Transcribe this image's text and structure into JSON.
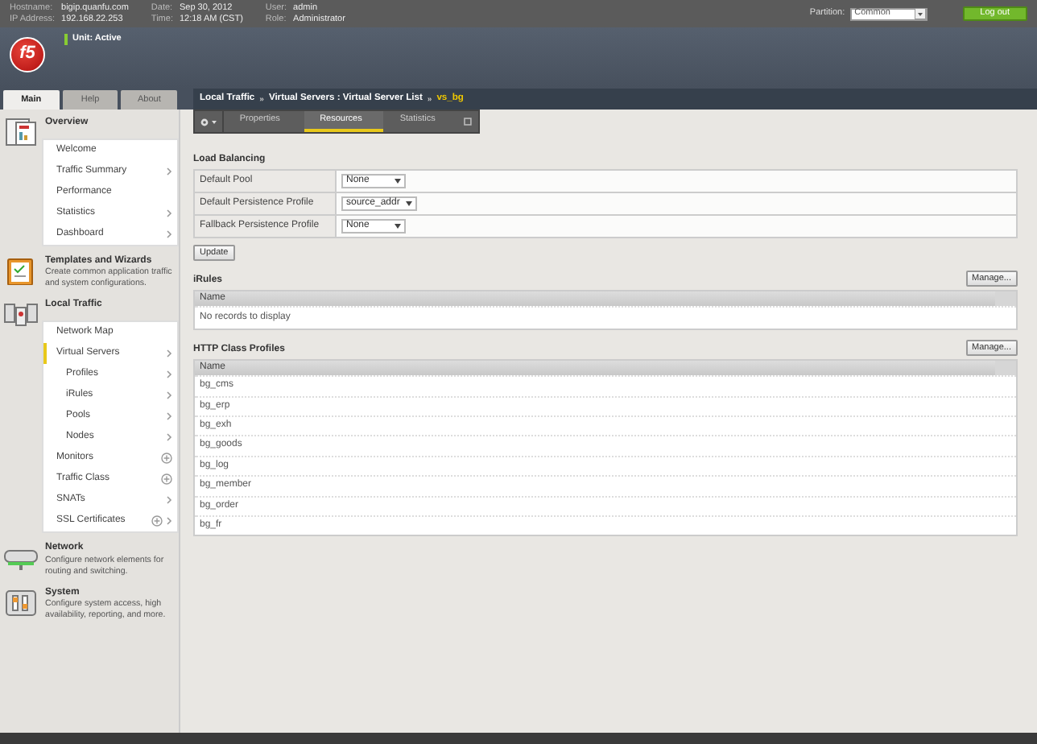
{
  "header": {
    "fields": [
      {
        "label": "Hostname:",
        "value": "bigip.quanfu.com"
      },
      {
        "label": "IP Address:",
        "value": "192.168.22.253"
      },
      {
        "label": "Date:",
        "value": "Sep 30, 2012"
      },
      {
        "label": "Time:",
        "value": "12:18 AM (CST)"
      },
      {
        "label": "User:",
        "value": "admin"
      },
      {
        "label": "Role:",
        "value": "Administrator"
      }
    ],
    "partition": {
      "label": "Partition:",
      "value": "Common"
    },
    "logout": "Log out"
  },
  "banner": {
    "logo": "f5",
    "unit_status": "Unit: Active"
  },
  "side_tabs": [
    {
      "label": "Main",
      "selected": true
    },
    {
      "label": "Help",
      "selected": false
    },
    {
      "label": "About",
      "selected": false
    }
  ],
  "sidebar": [
    {
      "title": "Overview",
      "items": [
        {
          "label": "Welcome",
          "selected": false,
          "submenu": false,
          "add": false
        },
        {
          "label": "Traffic Summary",
          "selected": false,
          "submenu": true,
          "add": false
        },
        {
          "label": "Performance",
          "selected": false,
          "submenu": false,
          "add": false
        },
        {
          "label": "Statistics",
          "selected": false,
          "submenu": true,
          "add": false
        },
        {
          "label": "Dashboard",
          "selected": false,
          "submenu": true,
          "add": false
        }
      ]
    },
    {
      "title": "Templates and Wizards",
      "description": "Create common application traffic and system configurations."
    },
    {
      "title": "Local Traffic",
      "items": [
        {
          "label": "Network Map",
          "selected": false,
          "submenu": false,
          "add": false
        },
        {
          "label": "Virtual Servers",
          "selected": true,
          "submenu": true,
          "add": false,
          "children": [
            {
              "label": "Profiles",
              "selected": false,
              "submenu": true,
              "add": false
            },
            {
              "label": "iRules",
              "selected": false,
              "submenu": true,
              "add": false
            },
            {
              "label": "Pools",
              "selected": false,
              "submenu": true,
              "add": false
            },
            {
              "label": "Nodes",
              "selected": false,
              "submenu": true,
              "add": false
            }
          ]
        },
        {
          "label": "Monitors",
          "selected": false,
          "submenu": false,
          "add": true
        },
        {
          "label": "Traffic Class",
          "selected": false,
          "submenu": false,
          "add": true
        },
        {
          "label": "SNATs",
          "selected": false,
          "submenu": true,
          "add": false
        },
        {
          "label": "SSL Certificates",
          "selected": false,
          "submenu": true,
          "add": true
        }
      ]
    },
    {
      "title": "Network",
      "description": "Configure network elements for routing and switching."
    },
    {
      "title": "System",
      "description": "Configure system access, high availability, reporting, and more."
    }
  ],
  "breadcrumb": {
    "parts": [
      "Local Traffic",
      "Virtual Servers : Virtual Server List"
    ],
    "separator": "»",
    "current": "vs_bg"
  },
  "content_tabs": [
    {
      "label": "Properties",
      "selected": false
    },
    {
      "label": "Resources",
      "selected": true
    },
    {
      "label": "Statistics",
      "selected": false
    }
  ],
  "load_balancing": {
    "title": "Load Balancing",
    "rows": [
      {
        "label": "Default Pool",
        "value": "None"
      },
      {
        "label": "Default Persistence Profile",
        "value": "source_addr"
      },
      {
        "label": "Fallback Persistence Profile",
        "value": "None"
      }
    ],
    "button": "Update"
  },
  "irules": {
    "title": "iRules",
    "button": "Manage...",
    "column": "Name",
    "empty": "No records to display"
  },
  "http_class_profiles": {
    "title": "HTTP Class Profiles",
    "button": "Manage...",
    "column": "Name",
    "rows": [
      "bg_cms",
      "bg_erp",
      "bg_exh",
      "bg_goods",
      "bg_log",
      "bg_member",
      "bg_order",
      "bg_fr"
    ]
  }
}
